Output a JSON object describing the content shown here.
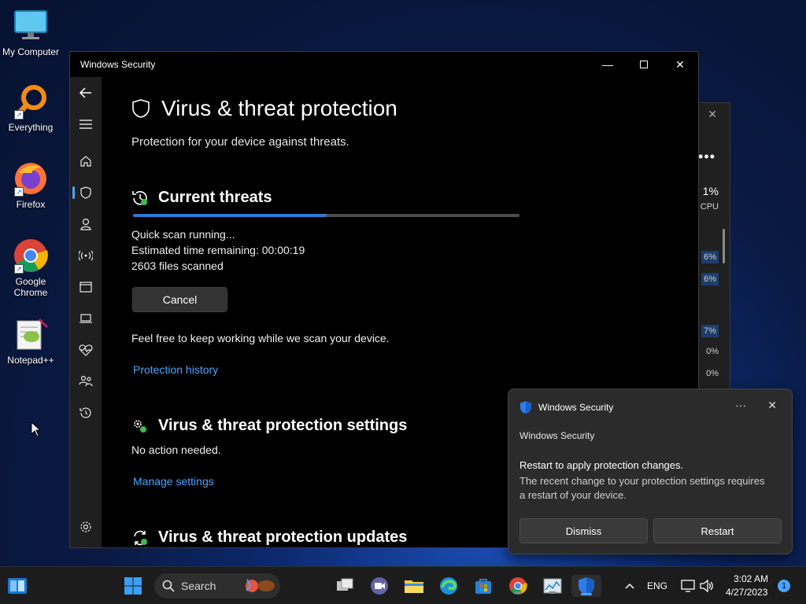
{
  "desktop": {
    "icons": [
      {
        "label": "My Computer"
      },
      {
        "label": "Everything"
      },
      {
        "label": "Firefox"
      },
      {
        "label": "Google Chrome"
      },
      {
        "label": "Notepad++"
      }
    ]
  },
  "background_window": {
    "cpu_percent": "1%",
    "cpu_label": "CPU",
    "rows": [
      "6%",
      "6%",
      "7%",
      "0%",
      "0%"
    ]
  },
  "window": {
    "title": "Windows Security"
  },
  "page": {
    "title": "Virus & threat protection",
    "subtitle": "Protection for your device against threats.",
    "current_threats": {
      "heading": "Current threats",
      "progress_fraction": 0.5,
      "status": "Quick scan running...",
      "time_remaining": "Estimated time remaining:  00:00:19",
      "files_scanned": "2603  files scanned",
      "cancel_label": "Cancel",
      "info": "Feel free to keep working while we scan your device.",
      "history_link": "Protection history"
    },
    "settings": {
      "heading": "Virus & threat protection settings",
      "status": "No action needed.",
      "manage_link": "Manage settings"
    },
    "updates": {
      "heading": "Virus & threat protection updates"
    }
  },
  "toast": {
    "header": "Windows Security",
    "app_name": "Windows Security",
    "title": "Restart to apply protection changes.",
    "body": "The recent change to your protection settings requires a restart of your device.",
    "dismiss_label": "Dismiss",
    "restart_label": "Restart",
    "more_glyph": "···",
    "close_glyph": "✕"
  },
  "taskbar": {
    "search_label": "Search",
    "language": "ENG",
    "time": "3:02 AM",
    "date": "4/27/2023",
    "notification_count": "1"
  },
  "colors": {
    "accent": "#4aa3ff",
    "progress": "#2f78d6"
  }
}
